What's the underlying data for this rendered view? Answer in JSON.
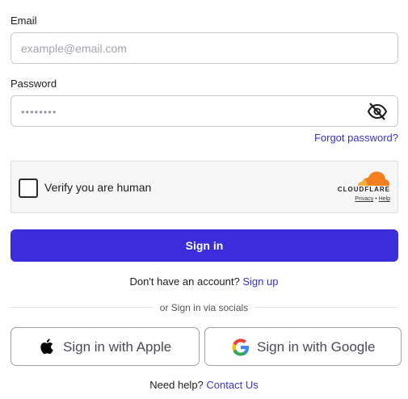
{
  "form": {
    "email_label": "Email",
    "email_placeholder": "example@email.com",
    "password_label": "Password",
    "password_mask": "••••••••",
    "forgot_password": "Forgot password?",
    "sign_in_label": "Sign in"
  },
  "captcha": {
    "checkbox_label": "Verify you are human",
    "brand": "CLOUDFLARE",
    "privacy_link": "Privacy",
    "separator": "•",
    "help_link": "Help",
    "checked": false
  },
  "signup": {
    "prompt": "Don't have an account?",
    "link": "Sign up"
  },
  "socials": {
    "divider_text": "or Sign in via socials",
    "apple_label": "Sign in with Apple",
    "google_label": "Sign in with Google"
  },
  "help": {
    "prompt": "Need help?",
    "link": "Contact Us"
  },
  "colors": {
    "primary": "#3b2ddb",
    "link": "#3a34c9",
    "cloudflare_orange": "#f38020"
  },
  "icons": {
    "password_toggle": "eye-slash-icon",
    "apple": "apple-icon",
    "google": "google-icon",
    "cloudflare": "cloudflare-logo"
  }
}
